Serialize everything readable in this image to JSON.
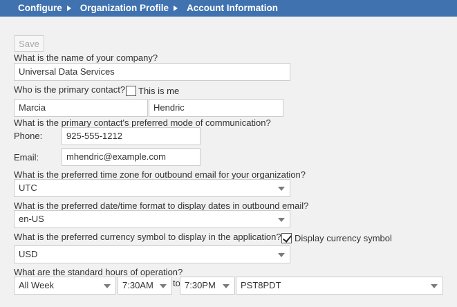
{
  "breadcrumb": {
    "items": [
      "Configure",
      "Organization Profile",
      "Account Information"
    ]
  },
  "toolbar": {
    "save_label": "Save"
  },
  "company": {
    "question": "What is the name of your company?",
    "value": "Universal Data Services"
  },
  "contact": {
    "question": "Who is the primary contact?",
    "this_is_me_label": "This is me",
    "this_is_me_checked": false,
    "first_name": "Marcia",
    "last_name": "Hendric"
  },
  "communication": {
    "question": "What is the primary contact's preferred mode of communication?",
    "phone_label": "Phone:",
    "phone_value": "925-555-1212",
    "email_label": "Email:",
    "email_value": "mhendric@example.com"
  },
  "timezone": {
    "question": "What is the preferred time zone for outbound email for your organization?",
    "value": "UTC"
  },
  "datetime_format": {
    "question": "What is the preferred date/time format to display dates in outbound email?",
    "value": "en-US"
  },
  "currency": {
    "question": "What is the preferred currency symbol to display in the application?",
    "display_label": "Display currency symbol",
    "display_checked": true,
    "value": "USD"
  },
  "hours": {
    "question": "What are the standard hours of operation?",
    "days": "All Week",
    "start": "7:30AM",
    "to_label": "to",
    "end": "7:30PM",
    "timezone": "PST8PDT"
  },
  "colors": {
    "header_bg": "#3f72af",
    "page_bg": "#f1f1f1"
  }
}
